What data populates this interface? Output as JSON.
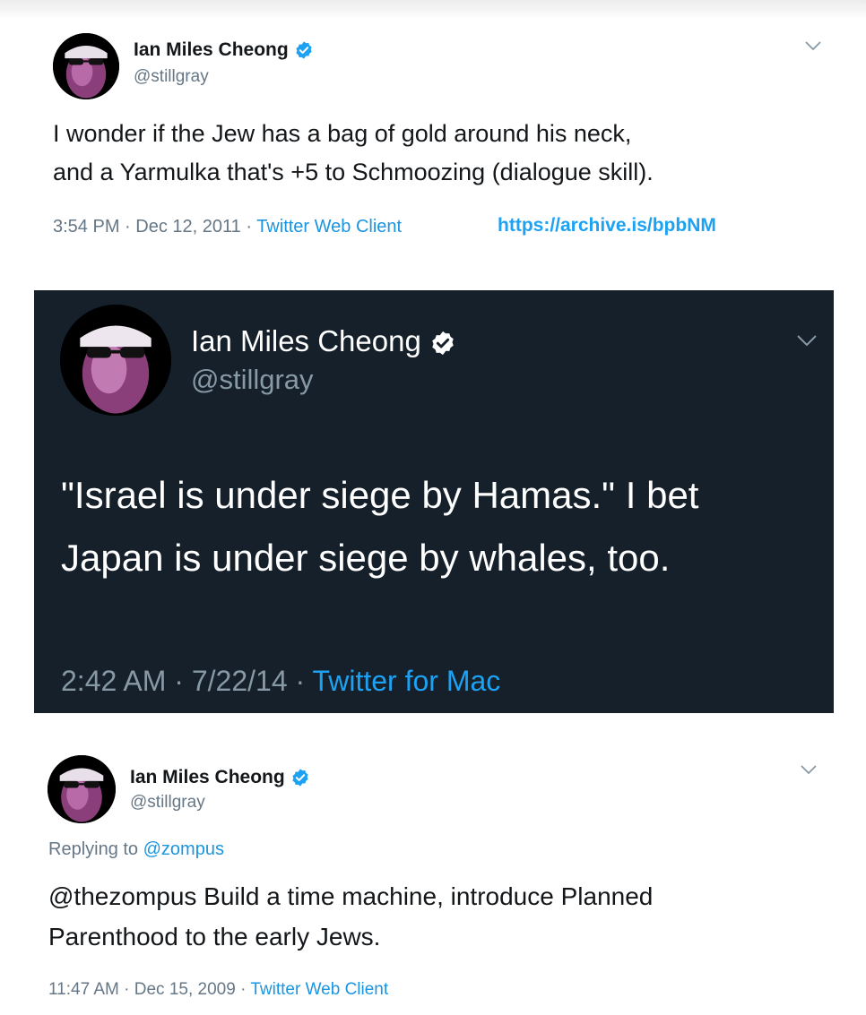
{
  "colors": {
    "twitter_blue": "#1da1f2",
    "link_blue": "#1b95e0",
    "dark_background": "#15202b",
    "muted_gray": "#657786"
  },
  "tweets": [
    {
      "author_name": "Ian Miles Cheong",
      "author_handle": "@stillgray",
      "verified_icon": "verified-badge-icon",
      "text_lines": [
        "I wonder if the Jew has a bag of gold around his neck,",
        "and a Yarmulka that's +5 to Schmoozing (dialogue skill)."
      ],
      "time": "3:54 PM",
      "date": "Dec 12, 2011",
      "source": "Twitter Web Client",
      "separator": " · ",
      "archive_link": "https://archive.is/bpbNM"
    },
    {
      "author_name": "Ian Miles Cheong",
      "author_handle": "@stillgray",
      "verified_icon": "verified-badge-icon",
      "theme": "dark",
      "text_lines": [
        "\"Israel is under siege by Hamas.\" I bet",
        "Japan is under siege by whales, too."
      ],
      "time": "2:42 AM",
      "date": "7/22/14",
      "source": "Twitter for Mac",
      "separator": " · "
    },
    {
      "author_name": "Ian Miles Cheong",
      "author_handle": "@stillgray",
      "verified_icon": "verified-badge-icon",
      "replying_prefix": "Replying to ",
      "replying_to": "@zompus",
      "text_lines": [
        "@thezompus Build a time machine, introduce Planned",
        "Parenthood to the early Jews."
      ],
      "time": "11:47 AM",
      "date": "Dec 15, 2009",
      "source": "Twitter Web Client",
      "separator": " · "
    }
  ]
}
